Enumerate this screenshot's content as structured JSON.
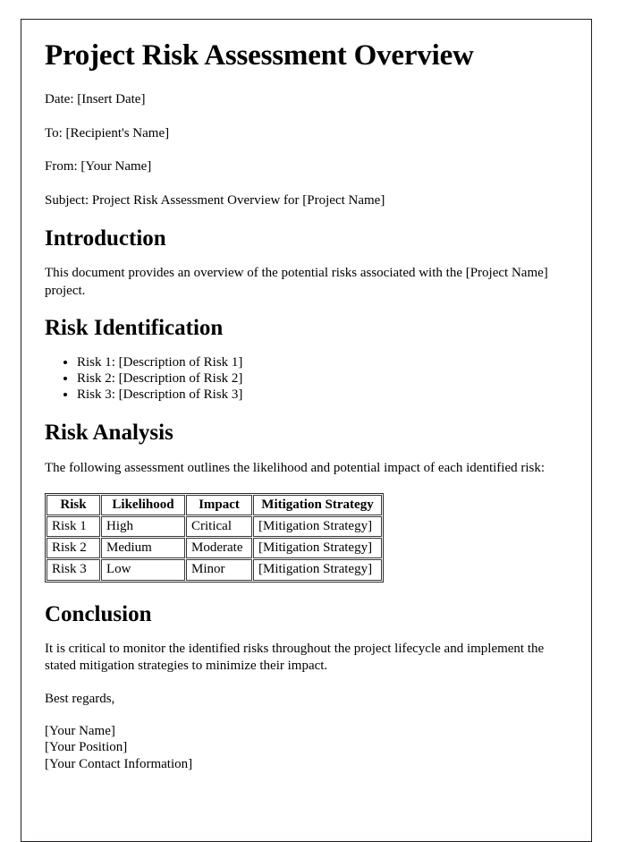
{
  "document": {
    "title": "Project Risk Assessment Overview",
    "meta": [
      "Date: [Insert Date]",
      "To: [Recipient's Name]",
      "From: [Your Name]",
      "Subject: Project Risk Assessment Overview for [Project Name]"
    ],
    "introduction": {
      "heading": "Introduction",
      "paragraph": "This document provides an overview of the potential risks associated with the [Project Name] project."
    },
    "risk_identification": {
      "heading": "Risk Identification",
      "items": [
        "Risk 1: [Description of Risk 1]",
        "Risk 2: [Description of Risk 2]",
        "Risk 3: [Description of Risk 3]"
      ]
    },
    "risk_analysis": {
      "heading": "Risk Analysis",
      "paragraph": "The following assessment outlines the likelihood and potential impact of each identified risk:",
      "table": {
        "columns": [
          "Risk",
          "Likelihood",
          "Impact",
          "Mitigation Strategy"
        ],
        "rows": [
          [
            "Risk 1",
            "High",
            "Critical",
            "[Mitigation Strategy]"
          ],
          [
            "Risk 2",
            "Medium",
            "Moderate",
            "[Mitigation Strategy]"
          ],
          [
            "Risk 3",
            "Low",
            "Minor",
            "[Mitigation Strategy]"
          ]
        ]
      }
    },
    "conclusion": {
      "heading": "Conclusion",
      "paragraph": "It is critical to monitor the identified risks throughout the project lifecycle and implement the stated mitigation strategies to minimize their impact."
    },
    "closing": {
      "salutation": "Best regards,",
      "signature": [
        "[Your Name]",
        "[Your Position]",
        "[Your Contact Information]"
      ]
    }
  }
}
